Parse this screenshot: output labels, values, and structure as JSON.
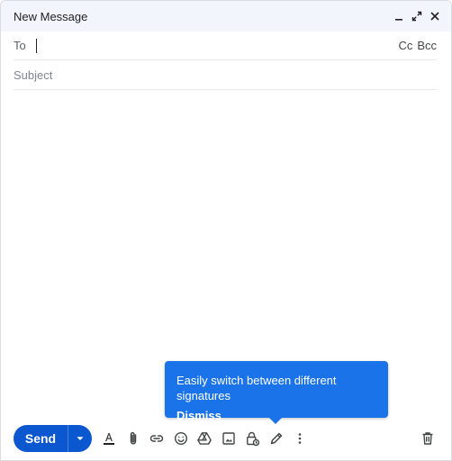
{
  "window": {
    "title": "New Message"
  },
  "window_controls": [
    "minimize-icon",
    "expand-icon",
    "close-icon"
  ],
  "to_field": {
    "label": "To",
    "value": ""
  },
  "cc_label": "Cc",
  "bcc_label": "Bcc",
  "subject_field": {
    "placeholder": "Subject",
    "value": ""
  },
  "tooltip": {
    "text": "Easily switch between different signatures",
    "dismiss_label": "Dismiss"
  },
  "toolbar": {
    "send_label": "Send",
    "icons": [
      "text-format-icon",
      "attach-icon",
      "link-icon",
      "emoji-icon",
      "drive-icon",
      "photo-icon",
      "confidential-mode-icon",
      "signature-icon",
      "more-options-icon",
      "discard-icon"
    ]
  },
  "colors": {
    "send_button": "#0b57d0",
    "tooltip_bg": "#1a73e8",
    "titlebar_bg": "#f2f6fc"
  }
}
